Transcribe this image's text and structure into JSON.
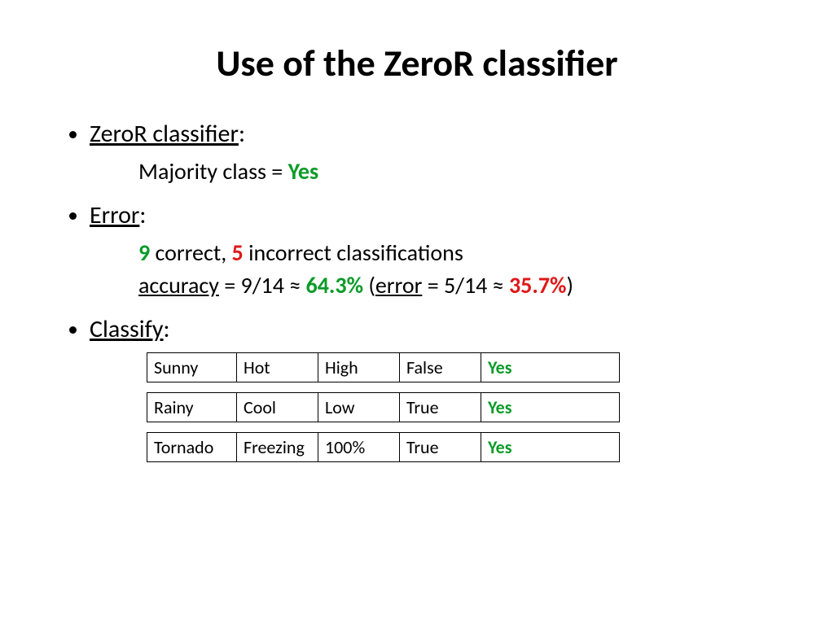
{
  "title": "Use of the ZeroR classifier",
  "bullets": {
    "b1": {
      "head": "ZeroR classifier"
    },
    "b1_sub": {
      "pre": "Majority class = ",
      "val": "Yes"
    },
    "b2": {
      "head": "Error"
    },
    "b2_sub1": {
      "n_correct": "9",
      "t1": " correct, ",
      "n_incorrect": "5",
      "t2": " incorrect classifications"
    },
    "b2_sub2": {
      "acc_word": "accuracy",
      "eq1": " = 9/14 ≈ ",
      "acc_val": "64.3%",
      "open": " (",
      "err_word": "error",
      "eq2": " = 5/14 ≈ ",
      "err_val": "35.7%",
      "close": ")"
    },
    "b3": {
      "head": "Classify"
    }
  },
  "table": {
    "rows": [
      {
        "c1": "Sunny",
        "c2": "Hot",
        "c3": "High",
        "c4": "False",
        "c5": "Yes"
      },
      {
        "c1": "Rainy",
        "c2": "Cool",
        "c3": "Low",
        "c4": "True",
        "c5": "Yes"
      },
      {
        "c1": "Tornado",
        "c2": "Freezing",
        "c3": "100%",
        "c4": "True",
        "c5": "Yes"
      }
    ]
  }
}
